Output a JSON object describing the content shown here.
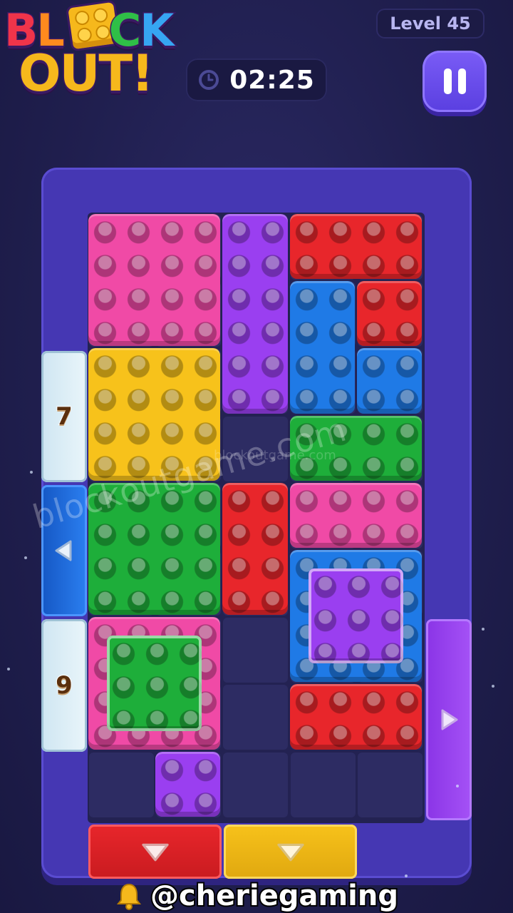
{
  "header": {
    "logo_line1": [
      "B",
      "L",
      "",
      "C",
      "K"
    ],
    "logo_line2": [
      "O",
      "U",
      "T",
      "!"
    ],
    "level_label": "Level 45",
    "timer": "02:25"
  },
  "board": {
    "columns": 5,
    "rows": 9,
    "blocks": [
      {
        "name": "pink-block-top",
        "color": "#f04aa6",
        "col": 0,
        "row": 0,
        "w": 2,
        "h": 2
      },
      {
        "name": "purple-block-tall",
        "color": "#9a3ff0",
        "col": 2,
        "row": 0,
        "w": 1,
        "h": 3
      },
      {
        "name": "red-block-top-right",
        "color": "#e8262b",
        "col": 3,
        "row": 0,
        "w": 2,
        "h": 1
      },
      {
        "name": "red-block-top-right-stem",
        "color": "#e8262b",
        "col": 4,
        "row": 1,
        "w": 1,
        "h": 1
      },
      {
        "name": "blue-l-block",
        "color": "#1f7ae6",
        "col": 3,
        "row": 1,
        "w": 1,
        "h": 2
      },
      {
        "name": "blue-l-block-foot",
        "color": "#1f7ae6",
        "col": 4,
        "row": 2,
        "w": 1,
        "h": 1
      },
      {
        "name": "yellow-block",
        "color": "#f7c21b",
        "col": 0,
        "row": 2,
        "w": 2,
        "h": 2
      },
      {
        "name": "green-block-right",
        "color": "#1eae3a",
        "col": 3,
        "row": 3,
        "w": 2,
        "h": 1
      },
      {
        "name": "green-block-left",
        "color": "#1eae3a",
        "col": 0,
        "row": 4,
        "w": 2,
        "h": 2
      },
      {
        "name": "red-block-middle",
        "color": "#e8262b",
        "col": 2,
        "row": 4,
        "w": 1,
        "h": 2
      },
      {
        "name": "pink-block-middle",
        "color": "#f04aa6",
        "col": 3,
        "row": 4,
        "w": 2,
        "h": 1
      },
      {
        "name": "blue-frame-block",
        "color": "#1f7ae6",
        "col": 3,
        "row": 5,
        "w": 2,
        "h": 2
      },
      {
        "name": "pink-frame-block",
        "color": "#f04aa6",
        "col": 0,
        "row": 6,
        "w": 2,
        "h": 2
      },
      {
        "name": "red-block-bottom",
        "color": "#e8262b",
        "col": 3,
        "row": 7,
        "w": 2,
        "h": 1
      },
      {
        "name": "purple-block-small",
        "color": "#9a3ff0",
        "col": 1,
        "row": 8,
        "w": 1,
        "h": 1
      }
    ],
    "inner_blocks": [
      {
        "name": "purple-inner-block",
        "color": "#9a3ff0",
        "col": 3,
        "row": 5
      },
      {
        "name": "green-inner-block",
        "color": "#1eae3a",
        "col": 0,
        "row": 6
      }
    ],
    "gates": [
      {
        "name": "left-gate-locked-7",
        "side": "left",
        "type": "locked",
        "label": "7"
      },
      {
        "name": "left-gate-blue",
        "side": "left",
        "type": "exit",
        "color": "#1f6fe0",
        "arrow": "left"
      },
      {
        "name": "left-gate-locked-9",
        "side": "left",
        "type": "locked",
        "label": "9"
      },
      {
        "name": "right-gate-purple",
        "side": "right",
        "type": "exit",
        "color": "#9a3ff0",
        "arrow": "right"
      },
      {
        "name": "bottom-gate-red",
        "side": "bottom",
        "type": "exit",
        "color": "#e8262b",
        "arrow": "down"
      },
      {
        "name": "bottom-gate-yellow",
        "side": "bottom",
        "type": "exit",
        "color": "#f7c21b",
        "arrow": "down"
      }
    ]
  },
  "watermark": "blockoutgame.com",
  "footer": {
    "icon": "bell-icon",
    "handle": "@cheriegaming"
  }
}
